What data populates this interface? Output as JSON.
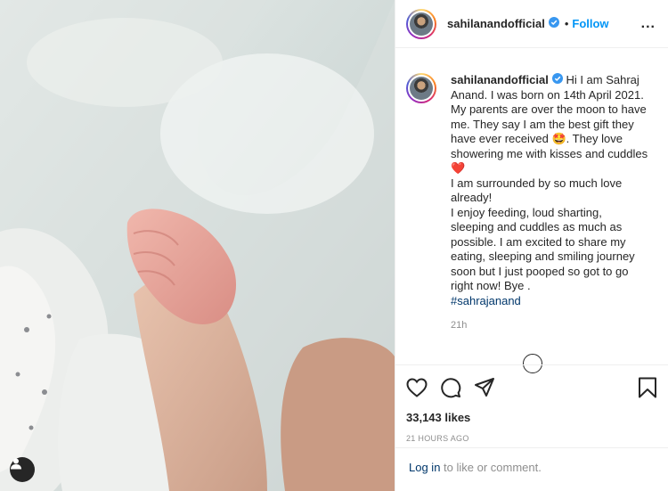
{
  "post": {
    "username": "sahilanandofficial",
    "follow_label": "Follow",
    "dot": "•",
    "more_label": "...",
    "caption": {
      "username": "sahilanandofficial",
      "text": "Hi I am Sahraj\nAnand. I was born on 14th April 2021.\nMy parents are over the moon to have\nme. They say I am the best gift they\nhave ever received 🤩. They love\nshowering me with kisses and cuddles\n❤️\nI am surrounded by so much love\nalready!\nI enjoy feeding, loud sharting,\nsleeping and cuddles as much as\npossible. I am excited to share my\neating, sleeping and smiling journey\nsoon but I just pooped so got to go\nright now! Bye .",
      "hashtag": "#sahrajanand",
      "time": "21h"
    },
    "likes": "33,143 likes",
    "posted_ago": "21 HOURS AGO",
    "login_link": "Log in",
    "login_rest": " to like or comment."
  },
  "colors": {
    "accent": "#0095f6",
    "text": "#262626",
    "muted": "#8e8e8e",
    "link": "#00376b"
  },
  "icons": [
    "verified-icon",
    "heart-icon",
    "comment-icon",
    "share-icon",
    "bookmark-icon",
    "user-tag-icon",
    "load-more-icon"
  ]
}
